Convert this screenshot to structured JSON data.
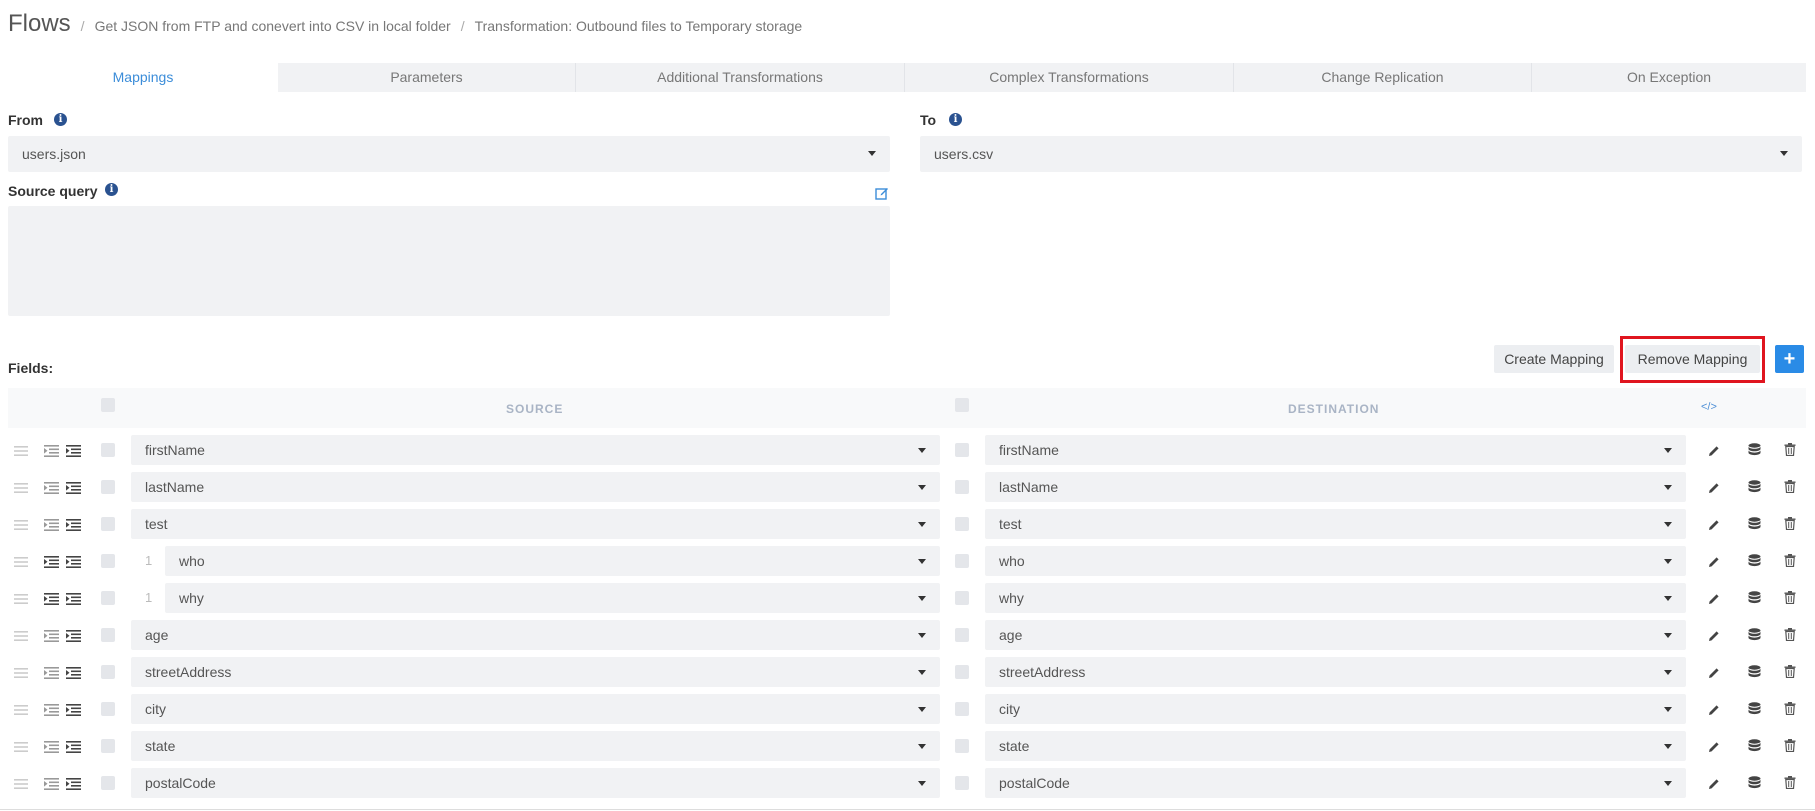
{
  "breadcrumb": {
    "root": "Flows",
    "items": [
      "Get JSON from FTP and conevert into CSV in local folder",
      "Transformation: Outbound files to Temporary storage"
    ]
  },
  "tabs": [
    {
      "label": "Mappings",
      "active": true
    },
    {
      "label": "Parameters"
    },
    {
      "label": "Additional Transformations"
    },
    {
      "label": "Complex Transformations"
    },
    {
      "label": "Change Replication"
    },
    {
      "label": "On Exception"
    }
  ],
  "from": {
    "label": "From",
    "value": "users.json"
  },
  "to": {
    "label": "To",
    "value": "users.csv"
  },
  "source_query": {
    "label": "Source query",
    "value": ""
  },
  "fields": {
    "label": "Fields:"
  },
  "buttons": {
    "create": "Create Mapping",
    "remove": "Remove Mapping",
    "add": "+"
  },
  "table": {
    "source_header": "SOURCE",
    "destination_header": "DESTINATION",
    "code_icon": "</>",
    "rows": [
      {
        "source": "firstName",
        "destination": "firstName"
      },
      {
        "source": "lastName",
        "destination": "lastName"
      },
      {
        "source": "test",
        "destination": "test"
      },
      {
        "source": "who",
        "destination": "who",
        "nested": "1"
      },
      {
        "source": "why",
        "destination": "why",
        "nested": "1"
      },
      {
        "source": "age",
        "destination": "age"
      },
      {
        "source": "streetAddress",
        "destination": "streetAddress"
      },
      {
        "source": "city",
        "destination": "city"
      },
      {
        "source": "state",
        "destination": "state"
      },
      {
        "source": "postalCode",
        "destination": "postalCode"
      }
    ]
  },
  "colors": {
    "accent": "#3c8dd9",
    "primary_button": "#2a8be6",
    "highlight": "#e0151f",
    "info": "#2a5290"
  }
}
